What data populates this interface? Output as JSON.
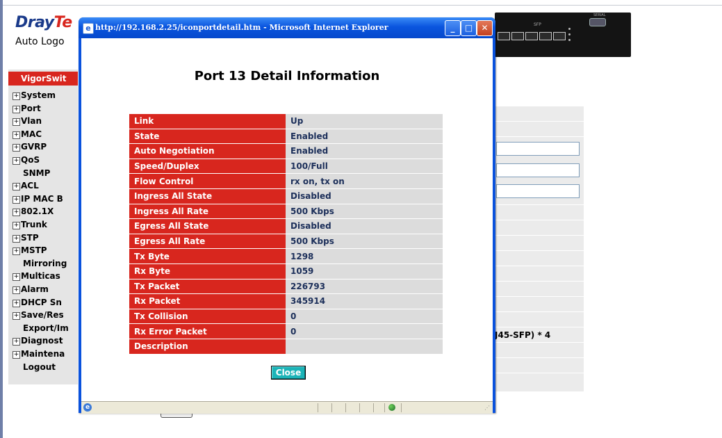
{
  "background": {
    "logo": {
      "brand_part1": "Dray",
      "brand_part2": "Te"
    },
    "auto_logout": "Auto Logo",
    "sidebar_header": "VigorSwit",
    "menu": [
      {
        "label": "System",
        "expandable": true
      },
      {
        "label": "Port",
        "expandable": true
      },
      {
        "label": "Vlan",
        "expandable": true
      },
      {
        "label": "MAC",
        "expandable": true
      },
      {
        "label": "GVRP",
        "expandable": true
      },
      {
        "label": "QoS",
        "expandable": true
      },
      {
        "label": "SNMP",
        "expandable": false
      },
      {
        "label": "ACL",
        "expandable": true
      },
      {
        "label": "IP MAC B",
        "expandable": true
      },
      {
        "label": "802.1X",
        "expandable": true
      },
      {
        "label": "Trunk",
        "expandable": true
      },
      {
        "label": "STP",
        "expandable": true
      },
      {
        "label": "MSTP",
        "expandable": true
      },
      {
        "label": "Mirroring",
        "expandable": false
      },
      {
        "label": "Multicas",
        "expandable": true
      },
      {
        "label": "Alarm",
        "expandable": true
      },
      {
        "label": "DHCP Sn",
        "expandable": true
      },
      {
        "label": "Save/Res",
        "expandable": true
      },
      {
        "label": "Export/Im",
        "expandable": false
      },
      {
        "label": "Diagnost",
        "expandable": true
      },
      {
        "label": "Maintena",
        "expandable": true
      },
      {
        "label": "Logout",
        "expandable": false
      }
    ],
    "partial_text": "J45-SFP) * 4",
    "device": {
      "sfp_label": "SFP",
      "serial_label": "SERIAL"
    }
  },
  "popup": {
    "window_title": "http://192.168.2.25/iconportdetail.htm - Microsoft Internet Explorer",
    "heading": "Port 13 Detail Information",
    "rows": [
      {
        "label": "Link",
        "value": "Up"
      },
      {
        "label": "State",
        "value": "Enabled"
      },
      {
        "label": "Auto Negotiation",
        "value": "Enabled"
      },
      {
        "label": "Speed/Duplex",
        "value": "100/Full"
      },
      {
        "label": "Flow Control",
        "value": "rx on, tx on"
      },
      {
        "label": "Ingress All State",
        "value": "Disabled"
      },
      {
        "label": "Ingress All Rate",
        "value": "500 Kbps"
      },
      {
        "label": "Egress All State",
        "value": "Disabled"
      },
      {
        "label": "Egress All Rate",
        "value": "500 Kbps"
      },
      {
        "label": "Tx Byte",
        "value": "1298"
      },
      {
        "label": "Rx Byte",
        "value": "1059"
      },
      {
        "label": "Tx Packet",
        "value": "226793"
      },
      {
        "label": "Rx Packet",
        "value": "345914"
      },
      {
        "label": "Tx Collision",
        "value": "0"
      },
      {
        "label": "Rx Error Packet",
        "value": "0"
      },
      {
        "label": "Description",
        "value": ""
      }
    ],
    "close_label": "Close",
    "icons": {
      "window": "ie-page-icon",
      "minimize": "minimize-icon",
      "maximize": "maximize-icon",
      "close": "close-icon",
      "status_page": "ie-page-icon",
      "status_zone": "internet-globe-icon"
    }
  },
  "colors": {
    "accent_red": "#d8261e",
    "value_cell": "#dcdcdc",
    "titlebar_blue": "#0a55de",
    "close_button": "#1cb4b8"
  }
}
